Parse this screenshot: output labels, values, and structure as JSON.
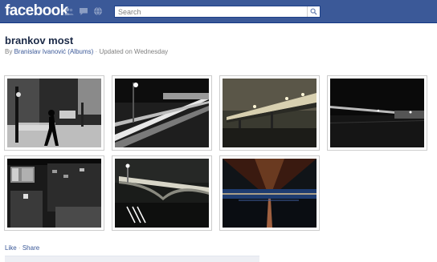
{
  "header": {
    "logo": "facebook",
    "jewels": [
      "friend-requests-icon",
      "messages-icon",
      "notifications-globe-icon"
    ],
    "search_placeholder": "Search"
  },
  "album": {
    "title": "brankov most",
    "by_prefix": "By",
    "owner": "Branislav Ivanović",
    "albums_link": "(Albums)",
    "separator": "·",
    "updated": "Updated on Wednesday"
  },
  "photos": [
    {
      "name": "photo-night-street"
    },
    {
      "name": "photo-light-trails"
    },
    {
      "name": "photo-bridge-lights"
    },
    {
      "name": "photo-bridge-dark"
    },
    {
      "name": "photo-window-reflection"
    },
    {
      "name": "photo-bridge-night"
    },
    {
      "name": "photo-under-bridge"
    }
  ],
  "actions": {
    "like": "Like",
    "dot": "·",
    "share": "Share"
  },
  "colors": {
    "brand_blue": "#3b5998",
    "link_blue": "#3b5998",
    "muted": "#808080"
  }
}
